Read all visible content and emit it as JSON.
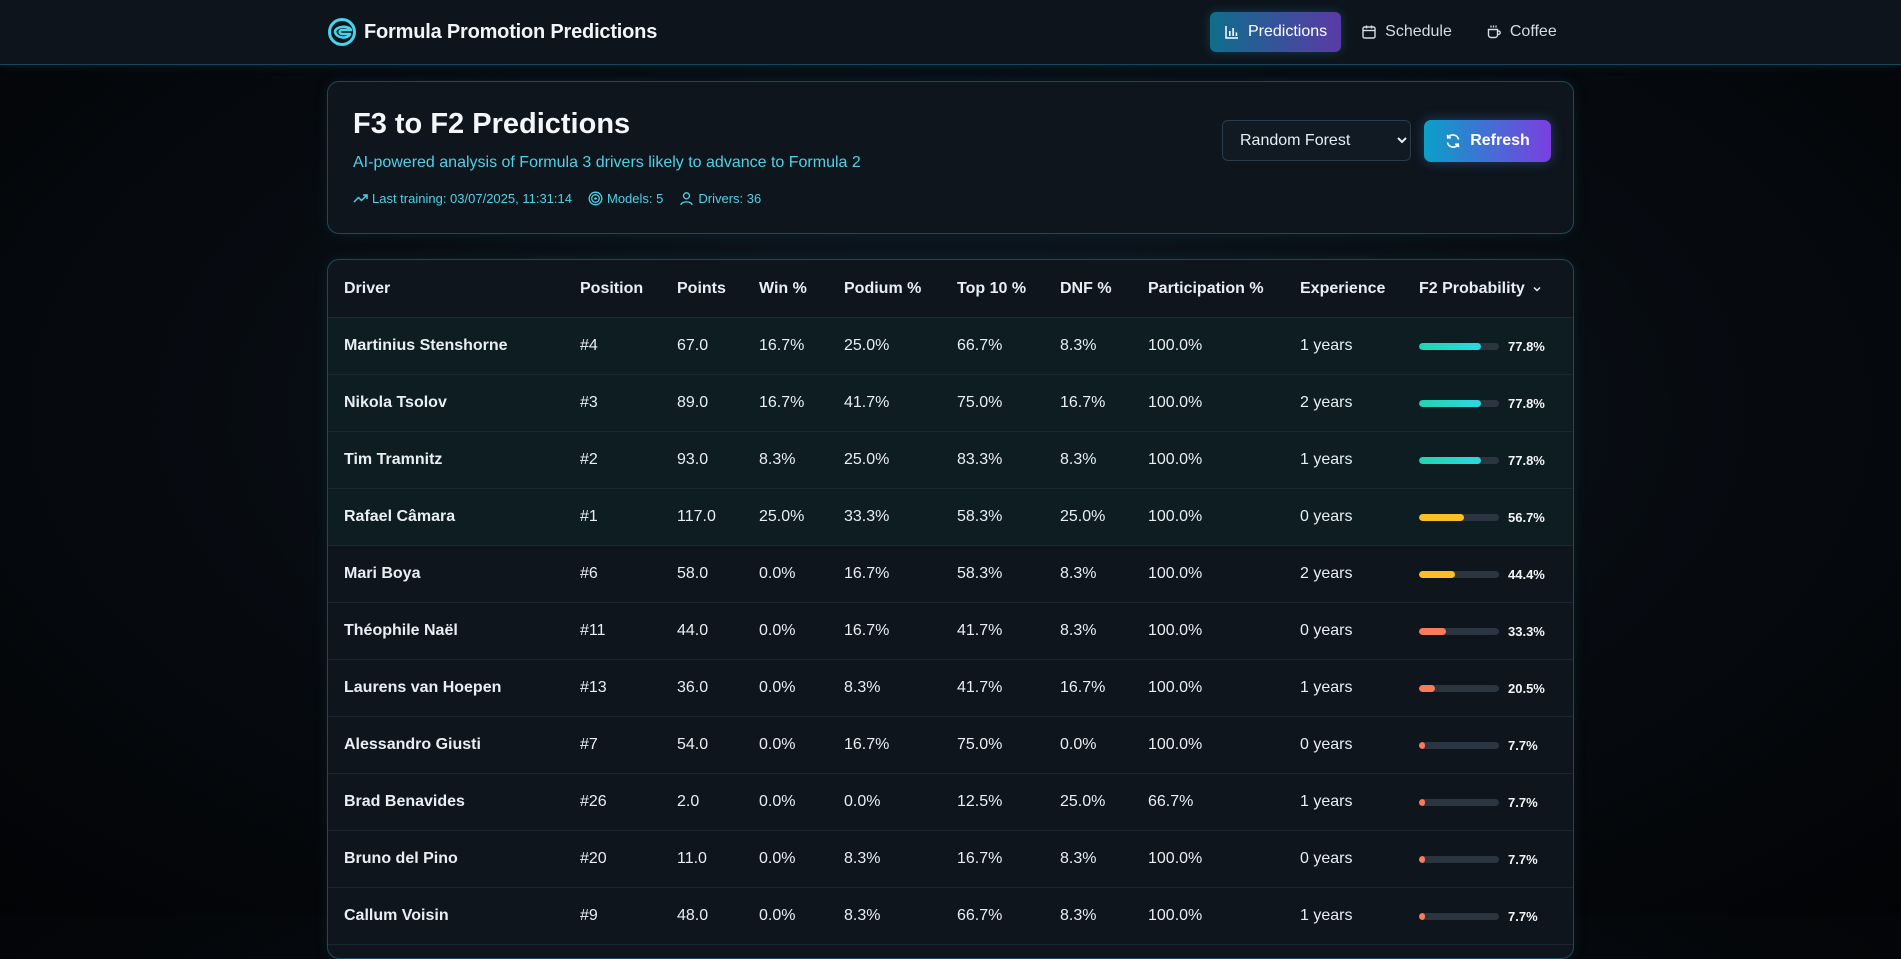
{
  "app": {
    "title": "Formula Promotion Predictions",
    "logo_icon": "helmet-logo-icon"
  },
  "nav": {
    "items": [
      {
        "label": "Predictions",
        "icon": "bar-chart-icon",
        "active": true
      },
      {
        "label": "Schedule",
        "icon": "calendar-icon",
        "active": false
      },
      {
        "label": "Coffee",
        "icon": "coffee-icon",
        "active": false
      }
    ]
  },
  "header": {
    "title": "F3 to F2 Predictions",
    "subtitle": "AI-powered analysis of Formula 3 drivers likely to advance to Formula 2",
    "last_training": "Last training: 03/07/2025, 11:31:14",
    "models": "Models: 5",
    "drivers": "Drivers: 36",
    "model_select": {
      "selected": "Random Forest"
    },
    "refresh_label": "Refresh"
  },
  "table": {
    "columns": [
      "Driver",
      "Position",
      "Points",
      "Win %",
      "Podium %",
      "Top 10 %",
      "DNF %",
      "Participation %",
      "Experience",
      "F2 Probability"
    ],
    "sorted_column": "F2 Probability",
    "rows": [
      {
        "driver": "Martinius Stenshorne",
        "position": "#4",
        "points": "67.0",
        "win": "16.7%",
        "podium": "25.0%",
        "top10": "66.7%",
        "dnf": "8.3%",
        "participation": "100.0%",
        "experience": "1 years",
        "prob": "77.8%",
        "prob_value": 77.8,
        "color": "green"
      },
      {
        "driver": "Nikola Tsolov",
        "position": "#3",
        "points": "89.0",
        "win": "16.7%",
        "podium": "41.7%",
        "top10": "75.0%",
        "dnf": "16.7%",
        "participation": "100.0%",
        "experience": "2 years",
        "prob": "77.8%",
        "prob_value": 77.8,
        "color": "green"
      },
      {
        "driver": "Tim Tramnitz",
        "position": "#2",
        "points": "93.0",
        "win": "8.3%",
        "podium": "25.0%",
        "top10": "83.3%",
        "dnf": "8.3%",
        "participation": "100.0%",
        "experience": "1 years",
        "prob": "77.8%",
        "prob_value": 77.8,
        "color": "green"
      },
      {
        "driver": "Rafael Câmara",
        "position": "#1",
        "points": "117.0",
        "win": "25.0%",
        "podium": "33.3%",
        "top10": "58.3%",
        "dnf": "25.0%",
        "participation": "100.0%",
        "experience": "0 years",
        "prob": "56.7%",
        "prob_value": 56.7,
        "color": "yellow"
      },
      {
        "driver": "Mari Boya",
        "position": "#6",
        "points": "58.0",
        "win": "0.0%",
        "podium": "16.7%",
        "top10": "58.3%",
        "dnf": "8.3%",
        "participation": "100.0%",
        "experience": "2 years",
        "prob": "44.4%",
        "prob_value": 44.4,
        "color": "yellow"
      },
      {
        "driver": "Théophile Naël",
        "position": "#11",
        "points": "44.0",
        "win": "0.0%",
        "podium": "16.7%",
        "top10": "41.7%",
        "dnf": "8.3%",
        "participation": "100.0%",
        "experience": "0 years",
        "prob": "33.3%",
        "prob_value": 33.3,
        "color": "red"
      },
      {
        "driver": "Laurens van Hoepen",
        "position": "#13",
        "points": "36.0",
        "win": "0.0%",
        "podium": "8.3%",
        "top10": "41.7%",
        "dnf": "16.7%",
        "participation": "100.0%",
        "experience": "1 years",
        "prob": "20.5%",
        "prob_value": 20.5,
        "color": "red"
      },
      {
        "driver": "Alessandro Giusti",
        "position": "#7",
        "points": "54.0",
        "win": "0.0%",
        "podium": "16.7%",
        "top10": "75.0%",
        "dnf": "0.0%",
        "participation": "100.0%",
        "experience": "0 years",
        "prob": "7.7%",
        "prob_value": 7.7,
        "color": "red"
      },
      {
        "driver": "Brad Benavides",
        "position": "#26",
        "points": "2.0",
        "win": "0.0%",
        "podium": "0.0%",
        "top10": "12.5%",
        "dnf": "25.0%",
        "participation": "66.7%",
        "experience": "1 years",
        "prob": "7.7%",
        "prob_value": 7.7,
        "color": "red"
      },
      {
        "driver": "Bruno del Pino",
        "position": "#20",
        "points": "11.0",
        "win": "0.0%",
        "podium": "8.3%",
        "top10": "16.7%",
        "dnf": "8.3%",
        "participation": "100.0%",
        "experience": "0 years",
        "prob": "7.7%",
        "prob_value": 7.7,
        "color": "red"
      },
      {
        "driver": "Callum Voisin",
        "position": "#9",
        "points": "48.0",
        "win": "0.0%",
        "podium": "8.3%",
        "top10": "66.7%",
        "dnf": "8.3%",
        "participation": "100.0%",
        "experience": "1 years",
        "prob": "7.7%",
        "prob_value": 7.7,
        "color": "red"
      }
    ]
  },
  "colors": {
    "green": "#22d3b0",
    "yellow": "#fbbf24",
    "red": "#fb7a5a",
    "accent": "#4fd2e6"
  }
}
